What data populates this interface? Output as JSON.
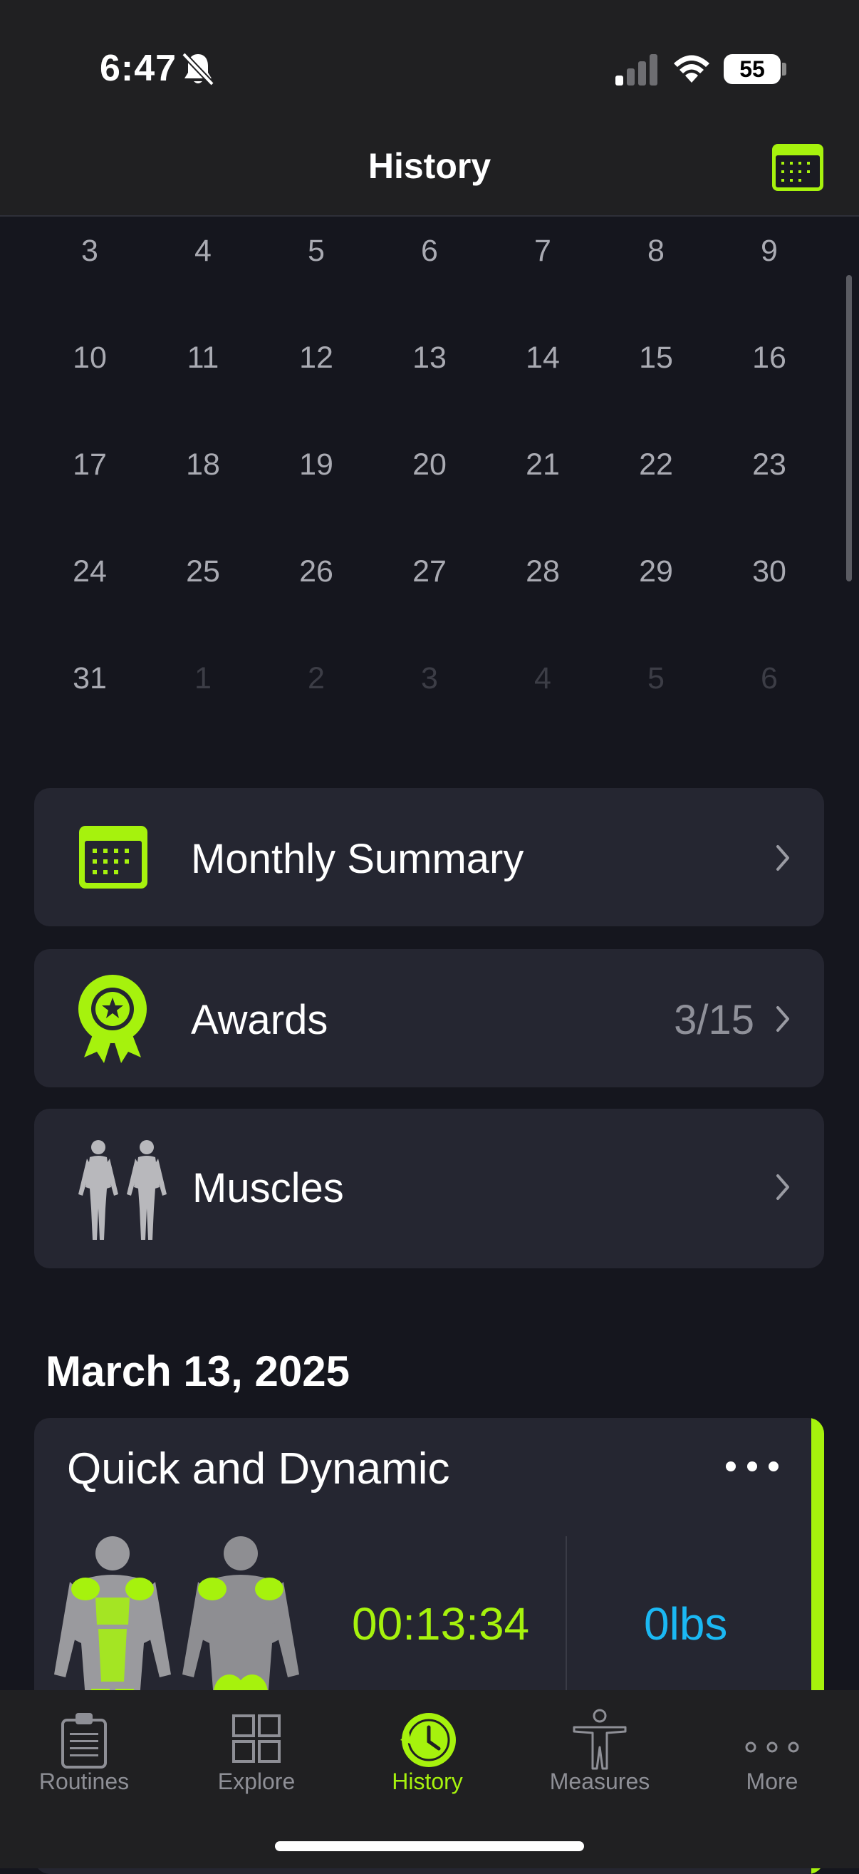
{
  "status_bar": {
    "time": "6:47",
    "battery": "55"
  },
  "nav": {
    "title": "History"
  },
  "calendar": {
    "weeks": [
      [
        {
          "d": "3"
        },
        {
          "d": "4"
        },
        {
          "d": "5"
        },
        {
          "d": "6"
        },
        {
          "d": "7"
        },
        {
          "d": "8"
        },
        {
          "d": "9"
        }
      ],
      [
        {
          "d": "10"
        },
        {
          "d": "11"
        },
        {
          "d": "12"
        },
        {
          "d": "13"
        },
        {
          "d": "14"
        },
        {
          "d": "15"
        },
        {
          "d": "16"
        }
      ],
      [
        {
          "d": "17"
        },
        {
          "d": "18"
        },
        {
          "d": "19"
        },
        {
          "d": "20"
        },
        {
          "d": "21"
        },
        {
          "d": "22"
        },
        {
          "d": "23"
        }
      ],
      [
        {
          "d": "24"
        },
        {
          "d": "25"
        },
        {
          "d": "26"
        },
        {
          "d": "27"
        },
        {
          "d": "28"
        },
        {
          "d": "29"
        },
        {
          "d": "30"
        }
      ],
      [
        {
          "d": "31"
        },
        {
          "d": "1",
          "dim": true
        },
        {
          "d": "2",
          "dim": true
        },
        {
          "d": "3",
          "dim": true
        },
        {
          "d": "4",
          "dim": true
        },
        {
          "d": "5",
          "dim": true
        },
        {
          "d": "6",
          "dim": true
        }
      ]
    ]
  },
  "menu": {
    "monthly_summary": {
      "label": "Monthly Summary",
      "icon": "calendar-icon"
    },
    "awards": {
      "label": "Awards",
      "count": "3/15",
      "icon": "award-ribbon-icon"
    },
    "muscles": {
      "label": "Muscles",
      "icon": "body-figures-icon"
    }
  },
  "history": {
    "date": "March 13, 2025",
    "workout": {
      "title": "Quick and Dynamic",
      "duration": "00:13:34",
      "weight": "0lbs"
    }
  },
  "tabs": [
    {
      "label": "Routines",
      "icon": "clipboard-icon"
    },
    {
      "label": "Explore",
      "icon": "grid-icon"
    },
    {
      "label": "History",
      "icon": "clock-history-icon",
      "active": true
    },
    {
      "label": "Measures",
      "icon": "person-icon"
    },
    {
      "label": "More",
      "icon": "ellipsis-icon"
    }
  ],
  "colors": {
    "accent": "#a6f20d",
    "weight_blue": "#1bb8f3",
    "card": "#252631",
    "background": "#15161e"
  }
}
